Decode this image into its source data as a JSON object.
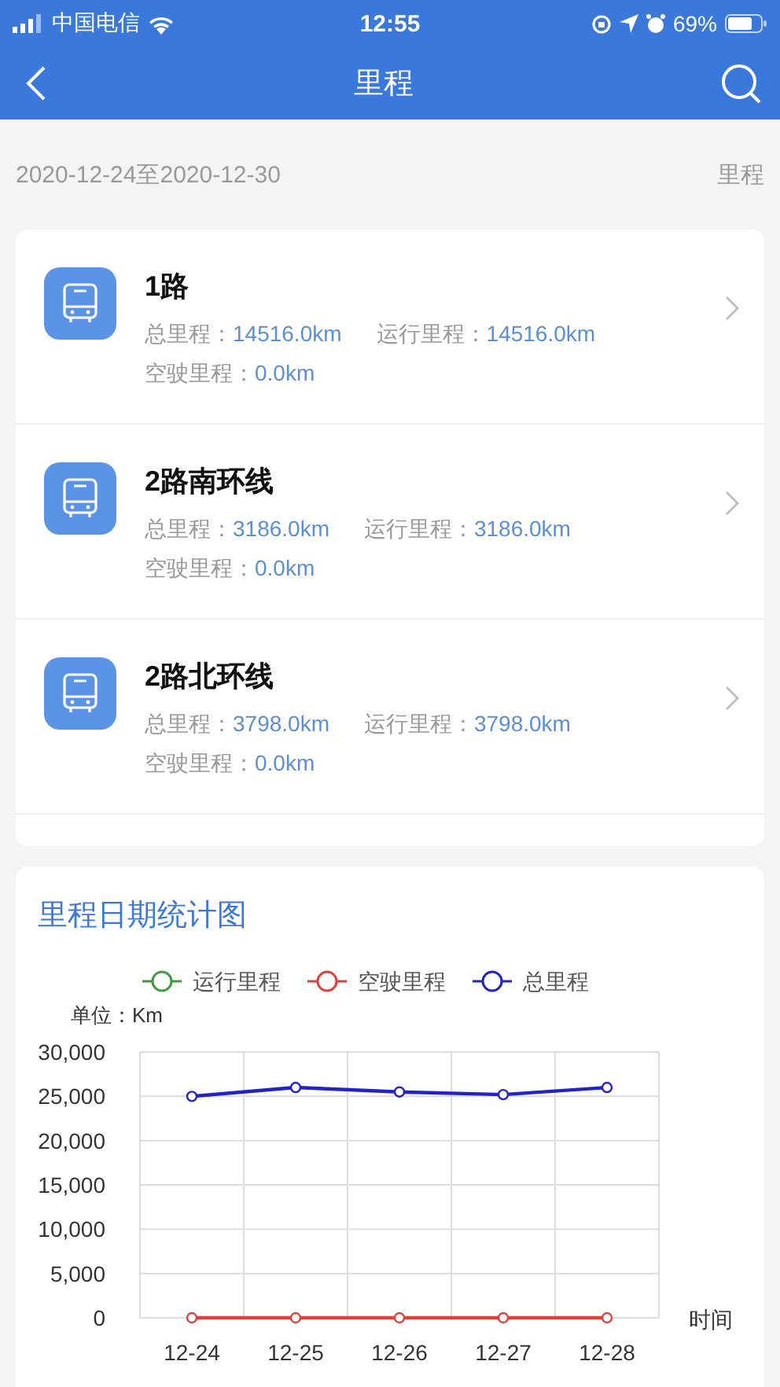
{
  "status_bar": {
    "carrier": "中国电信",
    "time": "12:55",
    "battery": "69%"
  },
  "nav": {
    "title": "里程"
  },
  "filter": {
    "date_range": "2020-12-24至2020-12-30",
    "label": "里程"
  },
  "routes": [
    {
      "name": "1路",
      "total_label": "总里程：",
      "total": "14516.0km",
      "run_label": "运行里程：",
      "run": "14516.0km",
      "empty_label": "空驶里程：",
      "empty": "0.0km"
    },
    {
      "name": "2路南环线",
      "total_label": "总里程：",
      "total": "3186.0km",
      "run_label": "运行里程：",
      "run": "3186.0km",
      "empty_label": "空驶里程：",
      "empty": "0.0km"
    },
    {
      "name": "2路北环线",
      "total_label": "总里程：",
      "total": "3798.0km",
      "run_label": "运行里程：",
      "run": "3798.0km",
      "empty_label": "空驶里程：",
      "empty": "0.0km"
    }
  ],
  "chart": {
    "title": "里程日期统计图",
    "chart_data": {
      "type": "line",
      "ylabel": "单位：Km",
      "xlabel": "时间",
      "categories": [
        "12-24",
        "12-25",
        "12-26",
        "12-27",
        "12-28"
      ],
      "series": [
        {
          "name": "运行里程",
          "color": "#3f9a3f",
          "marker": "circle",
          "values": [
            null,
            null,
            null,
            null,
            null
          ]
        },
        {
          "name": "空驶里程",
          "color": "#e0403a",
          "marker": "circle",
          "values": [
            0,
            0,
            0,
            0,
            0
          ]
        },
        {
          "name": "总里程",
          "color": "#2222cc",
          "marker": "circle",
          "values": [
            25000,
            26000,
            25500,
            25200,
            26000
          ]
        }
      ],
      "grid": true,
      "legend": true,
      "ylim": [
        0,
        30000
      ],
      "yticks": [
        {
          "value": 0,
          "label": "0"
        },
        {
          "value": 5000,
          "label": "5,000"
        },
        {
          "value": 10000,
          "label": "10,000"
        },
        {
          "value": 15000,
          "label": "15,000"
        },
        {
          "value": 20000,
          "label": "20,000"
        },
        {
          "value": 25000,
          "label": "25,000"
        },
        {
          "value": 30000,
          "label": "30,000"
        }
      ]
    }
  }
}
